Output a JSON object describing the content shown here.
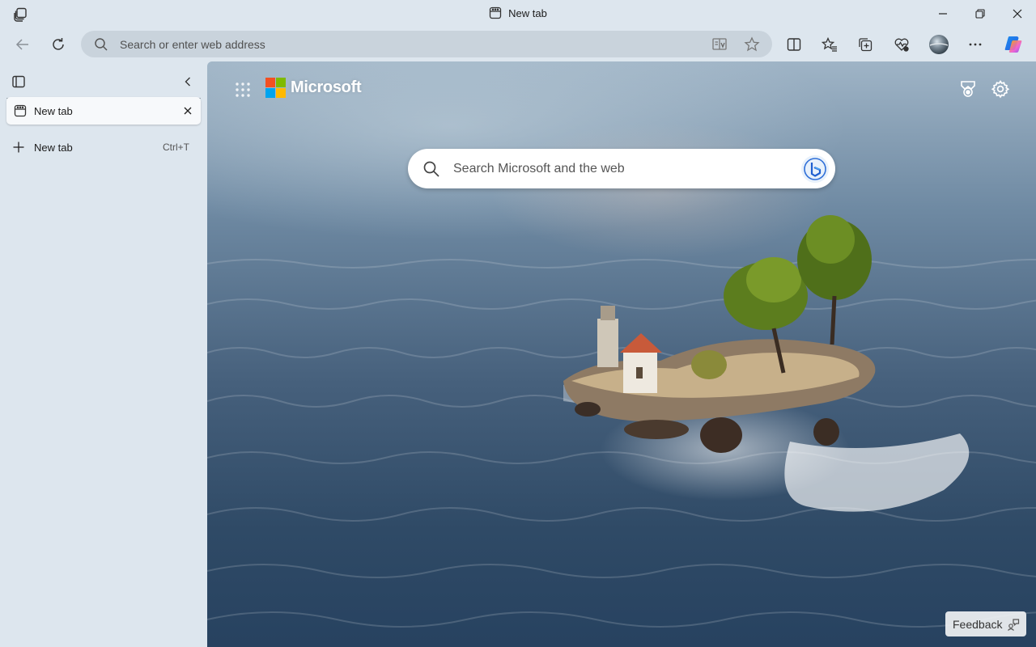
{
  "window": {
    "title": "New tab",
    "controls": {
      "minimize": "minimize",
      "restore": "restore",
      "close": "close"
    }
  },
  "toolbar": {
    "address_placeholder": "Search or enter web address",
    "buttons": [
      "back",
      "refresh",
      "immersive-reader",
      "favorite",
      "split-screen",
      "favorites",
      "collections",
      "browser-essentials",
      "profile",
      "more",
      "copilot"
    ]
  },
  "sidebar": {
    "tabs": [
      {
        "label": "New tab"
      }
    ],
    "new_tab": {
      "label": "New tab",
      "shortcut": "Ctrl+T"
    }
  },
  "newtab_page": {
    "brand": "Microsoft",
    "search_placeholder": "Search Microsoft and the web",
    "feedback_label": "Feedback"
  },
  "colors": {
    "ms_red": "#f25022",
    "ms_green": "#7fba00",
    "ms_blue": "#00a4ef",
    "ms_yellow": "#ffb900",
    "chrome_bg": "#dde6ee",
    "address_bg": "#c9d3dc"
  }
}
